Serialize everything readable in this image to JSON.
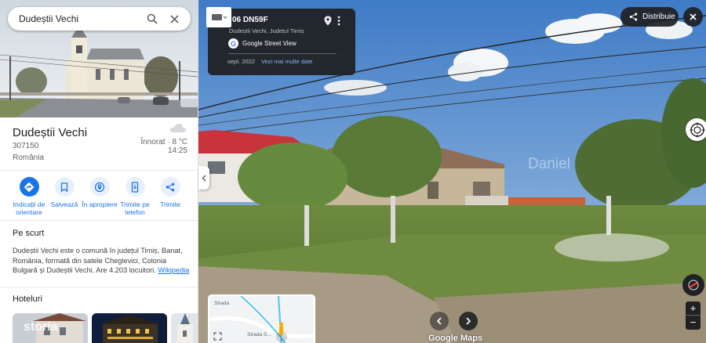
{
  "search": {
    "value": "Dudeștii Vechi"
  },
  "place": {
    "name": "Dudeștii Vechi",
    "postal_code": "307150",
    "country": "România",
    "weather": {
      "condition": "Înnorat",
      "temperature": "8 °C",
      "time": "14:25"
    }
  },
  "actions": [
    {
      "label": "Indicații de orientare",
      "icon": "directions-icon"
    },
    {
      "label": "Salvează",
      "icon": "bookmark-icon"
    },
    {
      "label": "În apropiere",
      "icon": "nearby-icon"
    },
    {
      "label": "Trimite pe telefon",
      "icon": "phone-icon"
    },
    {
      "label": "Trimite",
      "icon": "share-icon"
    }
  ],
  "overview": {
    "heading": "Pe scurt",
    "text": "Dudeștii Vechi este o comună în județul Timiș, Banat, România, formată din satele Cheglevici, Colonia Bulgară și Dudeștii Vechi. Are 4.203 locuitori.",
    "link": "Wikipedia"
  },
  "hotels": {
    "heading": "Hoteluri",
    "image_caption": "storia"
  },
  "streetview": {
    "road": "06 DN59F",
    "location": "Dudeștii Vechi, Județul Timiș",
    "source": "Google Street View",
    "date": "sept. 2022",
    "more_dates": "Vezi mai multe date",
    "share_label": "Distribuie",
    "watermark": "Daniel",
    "logo": "Google Maps",
    "minimap_streets": [
      "Strada",
      "Strada S..."
    ]
  },
  "colors": {
    "accent": "#1a73e8",
    "dark_ui": "#202124"
  }
}
